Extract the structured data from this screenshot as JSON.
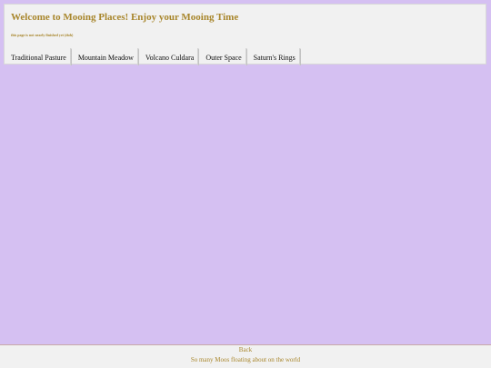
{
  "header": {
    "title": "Welcome to Mooing Places! Enjoy your Mooing Time",
    "subtitle": "this page is not nearly finished yet (duh)"
  },
  "tabs": [
    {
      "label": "Traditional Pasture"
    },
    {
      "label": "Mountain Meadow"
    },
    {
      "label": "Volcano Culdara"
    },
    {
      "label": "Outer Space"
    },
    {
      "label": "Saturn's Rings"
    }
  ],
  "footer": {
    "back_label": "Back",
    "tagline": "So many Moos floating about on the world"
  },
  "colors": {
    "page_background": "#d5c0f2",
    "panel_background": "#f1f1f1",
    "accent_text": "#a8862c"
  }
}
